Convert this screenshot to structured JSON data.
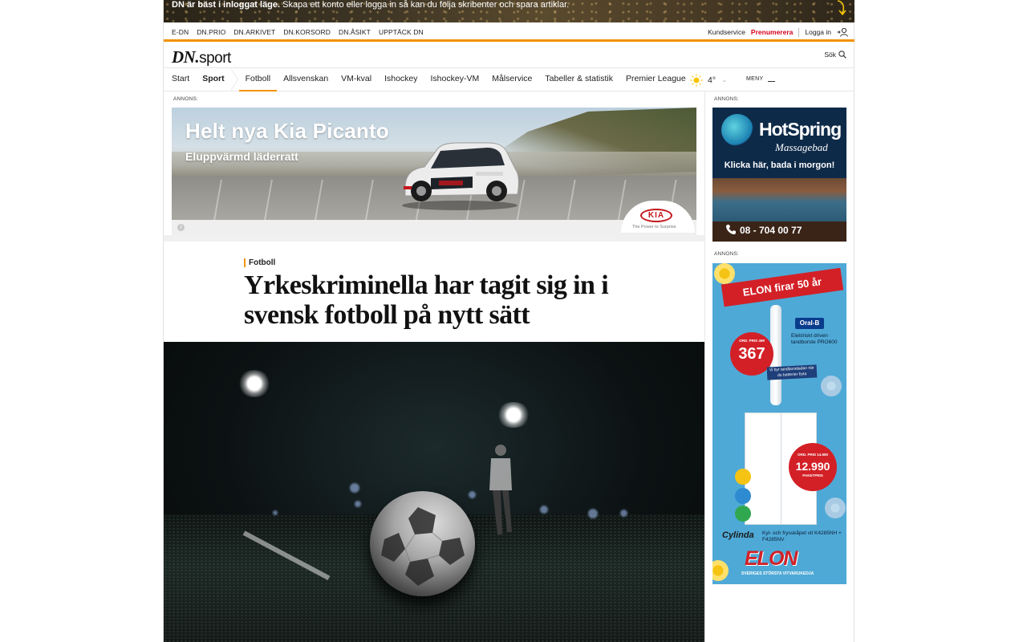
{
  "login_banner": {
    "bold": "DN är bäst i inloggat läge.",
    "text": " Skapa ett konto eller logga in så kan du följa skribenter och spara artiklar."
  },
  "toplinks": {
    "left": [
      "E-DN",
      "DN.PRIO",
      "DN.ARKIVET",
      "DN.KORSORD",
      "DN.ÅSIKT",
      "UPPTÄCK DN"
    ],
    "kundservice": "Kundservice",
    "prenumerera": "Prenumerera",
    "login": "Logga in"
  },
  "logo": {
    "brand": "DN.",
    "section": "sport"
  },
  "search": {
    "label": "Sök"
  },
  "nav": {
    "items": [
      {
        "label": "Start"
      },
      {
        "label": "Sport"
      },
      {
        "label": "Fotboll"
      },
      {
        "label": "Allsvenskan"
      },
      {
        "label": "VM-kval"
      },
      {
        "label": "Ishockey"
      },
      {
        "label": "Ishockey-VM"
      },
      {
        "label": "Målservice"
      },
      {
        "label": "Tabeller & statistik"
      },
      {
        "label": "Premier League"
      }
    ],
    "weather": "4°",
    "menu": "MENY"
  },
  "ads": {
    "label": "ANNONS:",
    "kia": {
      "headline": "Helt nya Kia Picanto",
      "sub": "Eluppvärmd läderratt",
      "brand": "KIA",
      "tagline": "The Power to Surprise"
    },
    "hotspring": {
      "brand": "HotSpring",
      "sub": "Massagebad",
      "cta": "Klicka här, bada i morgon!",
      "phone": "08 - 704 00 77"
    },
    "elon": {
      "banner": "ELON firar 50 år",
      "oralb": "Oral-B",
      "oralb_desc": "Elektriskt driven tandborste PRO600",
      "price1_small": "ORD. PRIS 499",
      "price1": "367",
      "pill": "Vi byr tandborstladan när du batterier byta",
      "price2_small": "ORD. PRIS 14.990",
      "price2": "12.990",
      "price2_sub": "PAKETPRIS",
      "cylinda": "Cylinda",
      "cylinda_desc": "Kyl- och frysskåpet vit K4285NH + F4285NV",
      "logo": "ELON",
      "tag": "SVERIGES STÖRSTA VITVARUKEDJA"
    }
  },
  "article": {
    "category": "Fotboll",
    "title": "Yrkeskriminella har tagit sig in i svensk fotboll på nytt sätt"
  },
  "colors": {
    "accent": "#f39200",
    "red": "#d6001c"
  }
}
